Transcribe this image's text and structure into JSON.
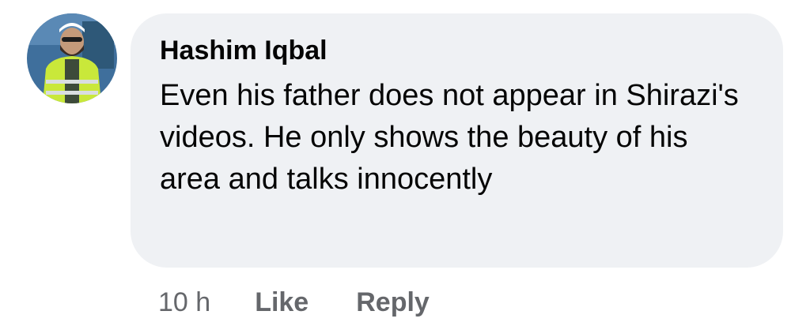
{
  "comment": {
    "author": "Hashim Iqbal",
    "text": "Even his father does not appear in Shirazi's videos. He only shows the beauty of his area and talks innocently",
    "timestamp": "10 h",
    "actions": {
      "like": "Like",
      "reply": "Reply"
    },
    "avatar_icon": "user-avatar-photo"
  },
  "colors": {
    "bubble_bg": "#eff1f4",
    "text": "#050505",
    "meta": "#65676b"
  }
}
